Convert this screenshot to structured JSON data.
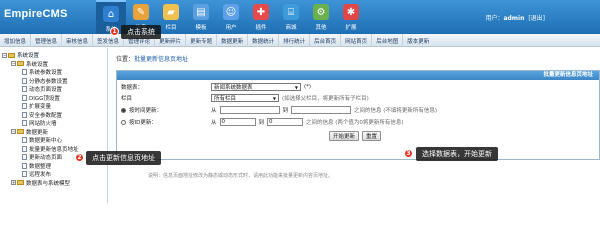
{
  "app": {
    "logo": "EmpireCMS"
  },
  "topnav": [
    {
      "label": "系统",
      "icon": "house-icon",
      "color": "#2f7fd0",
      "active": true
    },
    {
      "label": "信息",
      "icon": "edit-icon",
      "color": "#e8a23a"
    },
    {
      "label": "栏目",
      "icon": "folder-icon",
      "color": "#f0c050"
    },
    {
      "label": "模板",
      "icon": "template-icon",
      "color": "#5aa0e0"
    },
    {
      "label": "用户",
      "icon": "user-icon",
      "color": "#5fa0ea"
    },
    {
      "label": "插件",
      "icon": "plugin-icon",
      "color": "#e64a4a"
    },
    {
      "label": "商城",
      "icon": "shop-icon",
      "color": "#3e9ad8"
    },
    {
      "label": "其他",
      "icon": "gear-icon",
      "color": "#6ab04c"
    },
    {
      "label": "扩展",
      "icon": "star-icon",
      "color": "#e04848"
    }
  ],
  "user": {
    "prefix": "用户：",
    "name": "admin",
    "logout": "[退出]"
  },
  "subnav": [
    "增加信息",
    "管理信息",
    "审核信息",
    "签发信息",
    "管理评论",
    "更新碎片",
    "更新专题",
    "数据更新",
    "数据统计",
    "排行统计",
    "后台首页",
    "网站首页",
    "后台地图",
    "版本更新"
  ],
  "sidebar": {
    "items": [
      {
        "label": "系统设置",
        "type": "root"
      },
      {
        "label": "系统设置",
        "type": "folder"
      },
      {
        "label": "系统参数设置",
        "type": "page"
      },
      {
        "label": "分静态参数设置",
        "type": "page"
      },
      {
        "label": "动态页面设置",
        "type": "page"
      },
      {
        "label": "DIGG顶设置",
        "type": "page"
      },
      {
        "label": "扩展变量",
        "type": "page"
      },
      {
        "label": "安全参数配置",
        "type": "page"
      },
      {
        "label": "网站防火墙",
        "type": "page"
      },
      {
        "label": "数据更新",
        "type": "folder"
      },
      {
        "label": "数据更新中心",
        "type": "page"
      },
      {
        "label": "批量更新信息页地址",
        "type": "page"
      },
      {
        "label": "更新动态页面",
        "type": "page"
      },
      {
        "label": "数据整理",
        "type": "page"
      },
      {
        "label": "远程发布",
        "type": "page"
      },
      {
        "label": "数据表与系统模型",
        "type": "folder"
      }
    ]
  },
  "location": {
    "prefix": "位置：",
    "link": "批量更新信息页地址"
  },
  "panel": {
    "title": "批量更新信息页地址",
    "table_label": "数据表：",
    "table_value": "新闻系统数据表",
    "required": "(*)",
    "column_label": "栏目",
    "column_value": "所有栏目",
    "column_hint": "(如选择父栏目，将更新所有子栏目)",
    "by_time_label": "按时间更新：",
    "from": "从",
    "to": "到",
    "by_time_hint": "之间的信息 (不填将更新所有信息)",
    "by_id_label": "按ID更新：",
    "id_from": "0",
    "id_to": "0",
    "by_id_hint": "之间的信息 (两个值为0将更新所有信息)",
    "start_button": "开始更新",
    "reset_button": "重置"
  },
  "footnote": "说明：信息页面地址修改为静态或动态形式时，请用此功能来批量更新内容页地址。",
  "callouts": [
    {
      "num": "1",
      "text": "点击系统"
    },
    {
      "num": "2",
      "text": "点击更新信息页地址"
    },
    {
      "num": "3",
      "text": "选择数据表，开始更新"
    }
  ]
}
